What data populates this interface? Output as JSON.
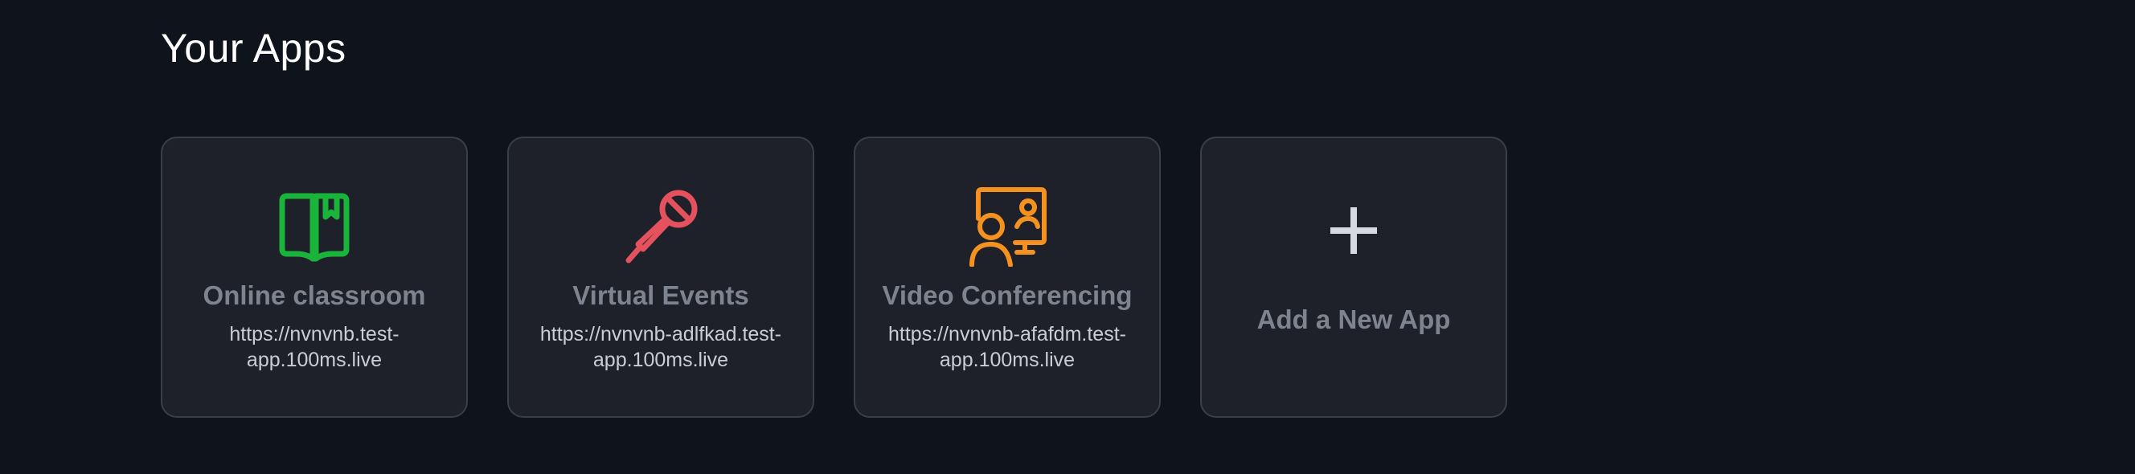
{
  "page": {
    "title": "Your Apps"
  },
  "apps": [
    {
      "title": "Online classroom",
      "url_line1": "https://nvnvnb.test-",
      "url_line2": "app.100ms.live",
      "icon": "book-icon",
      "color": "#1bb43a"
    },
    {
      "title": "Virtual Events",
      "url_line1": "https://nvnvnb-adlfkad.test-",
      "url_line2": "app.100ms.live",
      "icon": "microphone-icon",
      "color": "#e5525e"
    },
    {
      "title": "Video Conferencing",
      "url_line1": "https://nvnvnb-afafdm.test-",
      "url_line2": "app.100ms.live",
      "icon": "presenter-icon",
      "color": "#f5921f"
    }
  ],
  "add_app": {
    "label": "Add a New App",
    "icon": "plus-icon"
  },
  "colors": {
    "background": "#0f131b",
    "card": "#1e2129",
    "card_border": "#3a3e47",
    "title_text": "#7d838f"
  }
}
